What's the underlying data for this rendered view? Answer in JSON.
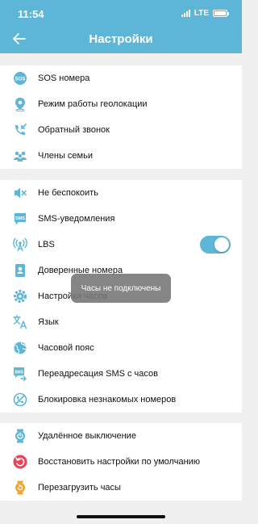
{
  "status_bar": {
    "time": "11:54",
    "network": "LTE"
  },
  "header": {
    "title": "Настройки"
  },
  "colors": {
    "accent": "#5db6d8",
    "reset_red": "#e8455c",
    "orange": "#f0a830"
  },
  "section1": [
    {
      "label": "SOS номера",
      "icon": "sos-icon"
    },
    {
      "label": "Режим работы геолокации",
      "icon": "location-icon"
    },
    {
      "label": "Обратный звонок",
      "icon": "callback-icon"
    },
    {
      "label": "Члены семьи",
      "icon": "family-icon"
    }
  ],
  "section2": [
    {
      "label": "Не беспокоить",
      "icon": "mute-icon"
    },
    {
      "label": "SMS-уведомления",
      "icon": "sms-icon"
    },
    {
      "label": "LBS",
      "icon": "antenna-icon",
      "toggle_on": true
    },
    {
      "label": "Доверенные номера",
      "icon": "contacts-icon"
    },
    {
      "label": "Настройки часов",
      "icon": "watch-settings-icon"
    },
    {
      "label": "Язык",
      "icon": "language-icon"
    },
    {
      "label": "Часовой пояс",
      "icon": "globe-icon"
    },
    {
      "label": "Переадресация SMS с часов",
      "icon": "sms-forward-icon"
    },
    {
      "label": "Блокировка незнакомых номеров",
      "icon": "block-call-icon"
    }
  ],
  "section3": [
    {
      "label": "Удалённое выключение",
      "icon": "power-icon"
    },
    {
      "label": "Восстановить настройки по умолчанию",
      "icon": "reset-icon"
    },
    {
      "label": "Перезагрузить часы",
      "icon": "restart-watch-icon"
    }
  ],
  "toast": {
    "text": "Часы не подключены"
  }
}
